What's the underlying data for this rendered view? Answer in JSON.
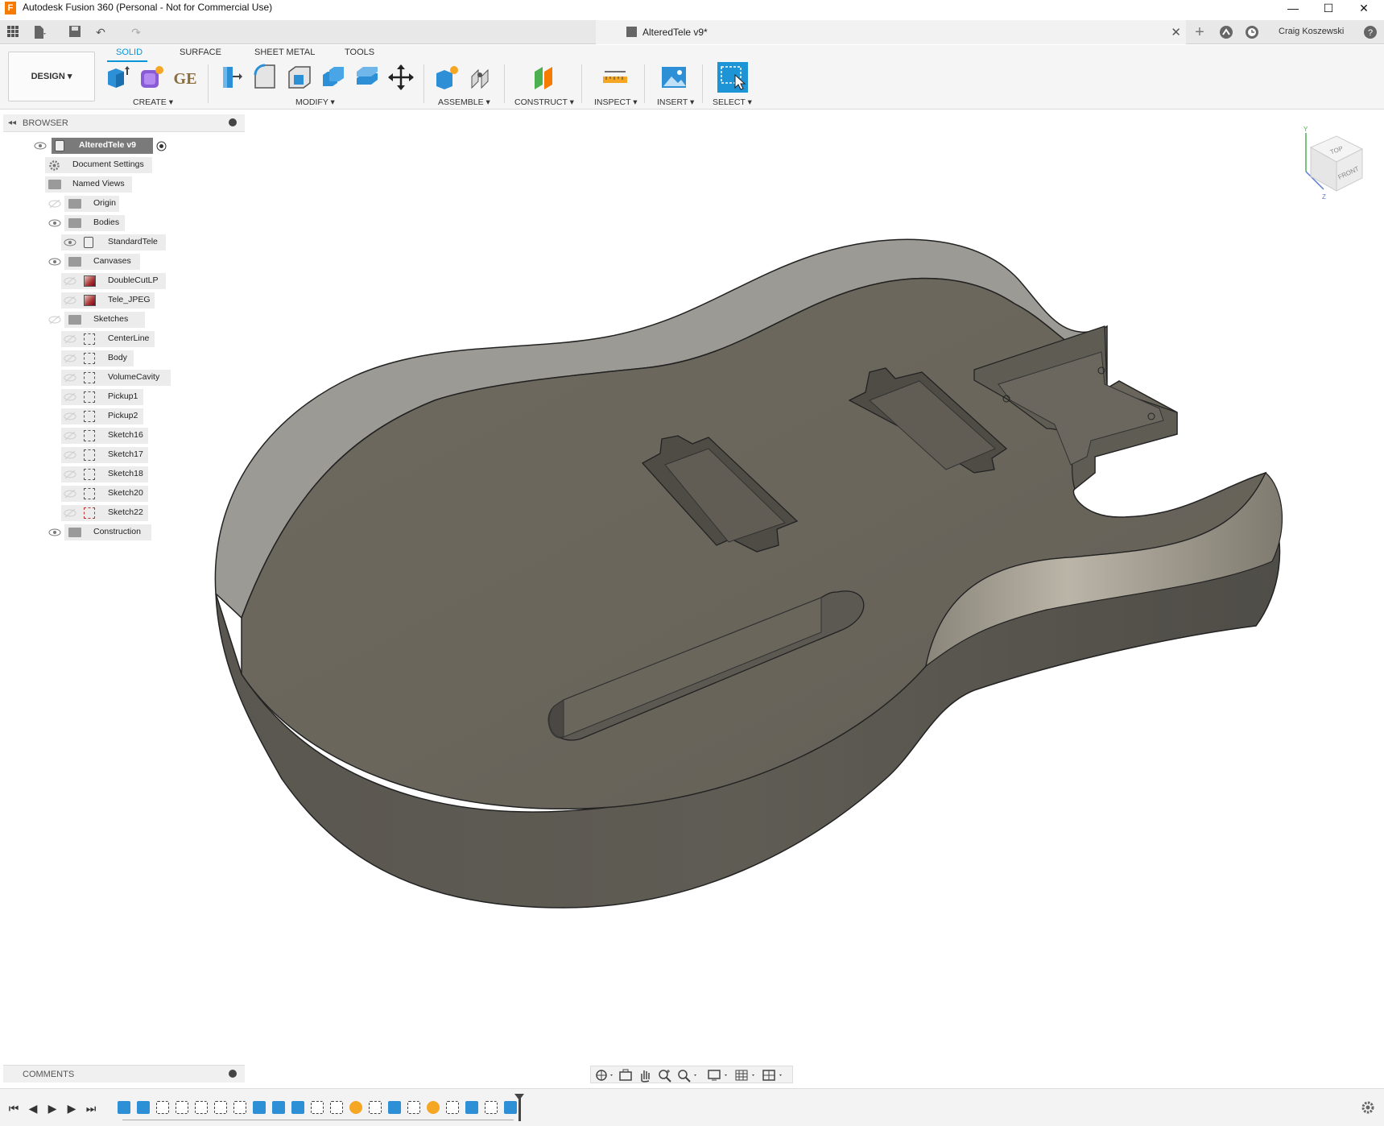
{
  "window": {
    "app_title": "Autodesk Fusion 360 (Personal - Not for Commercial Use)",
    "logo_letter": "F",
    "minimize": "—",
    "maximize": "☐",
    "close": "✕"
  },
  "doc_tab": {
    "title": "AlteredTele v9*",
    "close": "✕"
  },
  "user": {
    "name": "Craig Koszewski"
  },
  "toolbar": {
    "workspace": "DESIGN ▾",
    "tabs": [
      "SOLID",
      "SURFACE",
      "SHEET METAL",
      "TOOLS"
    ],
    "active_tab": "SOLID",
    "groups": [
      "CREATE ▾",
      "MODIFY ▾",
      "ASSEMBLE ▾",
      "CONSTRUCT ▾",
      "INSPECT ▾",
      "INSERT ▾",
      "SELECT ▾"
    ],
    "ge_label": "GE"
  },
  "browser": {
    "header": "BROWSER",
    "root": "AlteredTele v9",
    "items": [
      {
        "label": "Document Settings"
      },
      {
        "label": "Named Views"
      },
      {
        "label": "Origin"
      },
      {
        "label": "Bodies"
      },
      {
        "label": "StandardTele"
      },
      {
        "label": "Canvases"
      },
      {
        "label": "DoubleCutLP"
      },
      {
        "label": "Tele_JPEG"
      },
      {
        "label": "Sketches"
      },
      {
        "label": "CenterLine"
      },
      {
        "label": "Body"
      },
      {
        "label": "VolumeCavity"
      },
      {
        "label": "Pickup1"
      },
      {
        "label": "Pickup2"
      },
      {
        "label": "Sketch16"
      },
      {
        "label": "Sketch17"
      },
      {
        "label": "Sketch18"
      },
      {
        "label": "Sketch20"
      },
      {
        "label": "Sketch22"
      },
      {
        "label": "Construction"
      }
    ]
  },
  "viewcube": {
    "top": "TOP",
    "front": "FRONT",
    "axis_y": "Y",
    "axis_z": "Z"
  },
  "comments": {
    "header": "COMMENTS"
  },
  "colors": {
    "accent": "#0696d7",
    "body_top": "#6b675e",
    "body_wall": "#5a5750",
    "body_inner_wall": "#9a9a94"
  }
}
